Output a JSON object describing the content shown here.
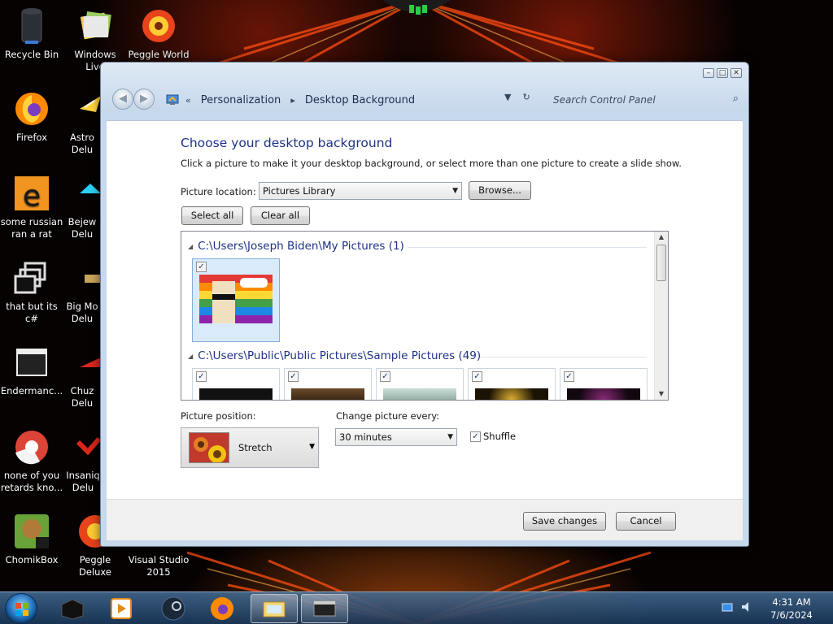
{
  "desktop": {
    "icons": [
      {
        "label": "Recycle Bin",
        "icon": "recycle-bin-icon"
      },
      {
        "label": "Windows Live\nMa",
        "icon": "windows-live-icon"
      },
      {
        "label": "Peggle World",
        "icon": "peggle-icon"
      },
      {
        "label": "Firefox",
        "icon": "firefox-icon"
      },
      {
        "label": "Astro\nDelu",
        "icon": "astro-icon"
      },
      {
        "label": "some russian\nran a rat",
        "icon": "ie-icon"
      },
      {
        "label": "Bejew\nDelu",
        "icon": "bejeweled-icon"
      },
      {
        "label": "that but its c#",
        "icon": "shortcut-icon"
      },
      {
        "label": "Big Mo\nDelu",
        "icon": "bigmoney-icon"
      },
      {
        "label": "Endermanc...",
        "icon": "app-window-icon"
      },
      {
        "label": "Chuz\nDelu",
        "icon": "chuzzle-icon"
      },
      {
        "label": "none of you\nretards kno...",
        "icon": "chrome-icon"
      },
      {
        "label": "Insaniq\nDelu",
        "icon": "insaniquarium-icon"
      },
      {
        "label": "ChomikBox",
        "icon": "chomikbox-icon"
      },
      {
        "label": "Peggle Deluxe",
        "icon": "peggle-deluxe-icon"
      },
      {
        "label": "Visual Studio\n2015",
        "icon": "visual-studio-icon"
      }
    ]
  },
  "window": {
    "caption_buttons": [
      "–",
      "□",
      "✕"
    ],
    "breadcrumb": {
      "chevrons": "«",
      "items": [
        "Personalization",
        "Desktop Background"
      ],
      "separator": "▸"
    },
    "search_placeholder": "Search Control Panel",
    "heading": "Choose your desktop background",
    "description": "Click a picture to make it your desktop background, or select more than one picture to create a slide show.",
    "picture_location_label": "Picture location:",
    "picture_location_value": "Pictures Library",
    "browse_label": "Browse...",
    "select_all_label": "Select all",
    "clear_all_label": "Clear all",
    "groups": [
      {
        "title": "C:\\Users\\Joseph Biden\\My Pictures (1)"
      },
      {
        "title": "C:\\Users\\Public\\Public Pictures\\Sample Pictures (49)"
      }
    ],
    "picture_position_label": "Picture position:",
    "picture_position_value": "Stretch",
    "change_every_label": "Change picture every:",
    "change_every_value": "30 minutes",
    "shuffle_label": "Shuffle",
    "shuffle_checked": true,
    "save_label": "Save changes",
    "cancel_label": "Cancel"
  },
  "taskbar": {
    "items": [
      "app-box-icon",
      "media-player-icon",
      "steam-icon",
      "firefox-icon",
      "explorer-icon",
      "app-window-icon"
    ],
    "clock_time": "4:31 AM",
    "clock_date": "7/6/2024"
  },
  "colors": {
    "accent_heading": "#1e3287",
    "window_frame": "#c6d8ec",
    "taskbar": "#2a5682"
  }
}
